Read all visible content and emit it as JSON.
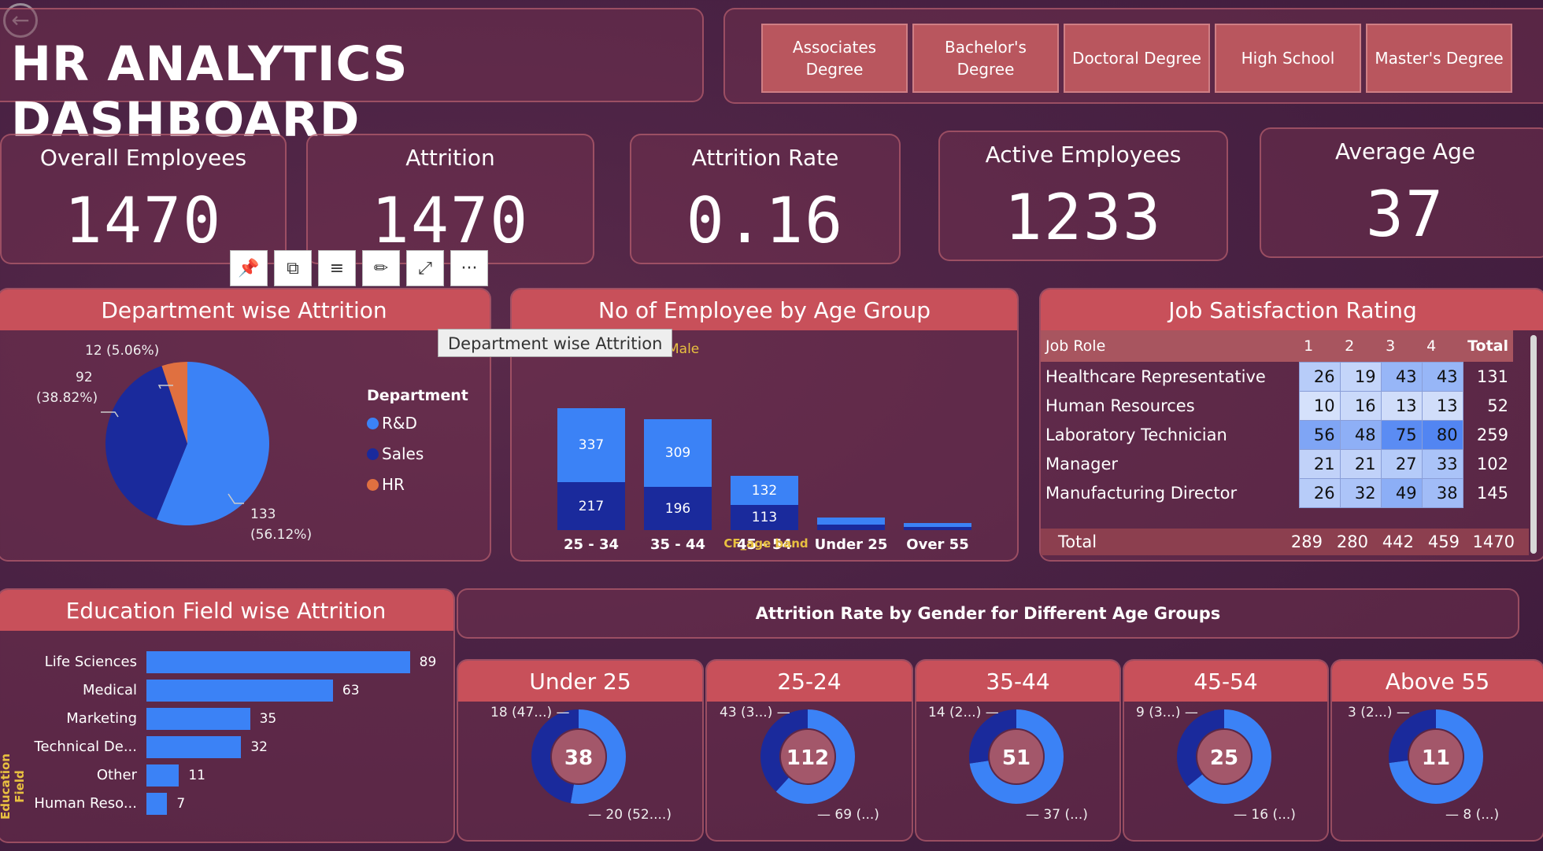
{
  "header": {
    "title": "HR ANALYTICS DASHBOARD",
    "back_icon": "arrow-left-icon"
  },
  "slicer": {
    "options": [
      "Associates Degree",
      "Bachelor's Degree",
      "Doctoral Degree",
      "High School",
      "Master's Degree"
    ]
  },
  "kpis": {
    "overall": {
      "label": "Overall Employees",
      "value": "1470"
    },
    "attrition": {
      "label": "Attrition",
      "value": "1470"
    },
    "rate": {
      "label": "Attrition Rate",
      "value": "0.16"
    },
    "active": {
      "label": "Active Employees",
      "value": "1233"
    },
    "avg_age": {
      "label": "Average Age",
      "value": "37"
    }
  },
  "toolbar": {
    "icons": [
      "pin-icon",
      "copy-icon",
      "filter-icon",
      "format-icon",
      "focus-mode-icon",
      "more-options-icon"
    ],
    "more_glyph": "···"
  },
  "tooltip": {
    "text": "Department wise Attrition"
  },
  "dept": {
    "title": "Department wise Attrition",
    "legend_title": "Department",
    "labels": {
      "hr": "12 (5.06%)",
      "sales_value": "92",
      "sales_pct": "(38.82%)",
      "rd_value": "133",
      "rd_pct": "(56.12%)"
    }
  },
  "age": {
    "title": "No of Employee by Age Group",
    "legend_partial": "Male",
    "xlabel": "CF_age band"
  },
  "job": {
    "title": "Job Satisfaction Rating",
    "headers": [
      "Job Role",
      "1",
      "2",
      "3",
      "4",
      "Total"
    ],
    "rows": [
      [
        "Healthcare Representative",
        "26",
        "19",
        "43",
        "43",
        "131"
      ],
      [
        "Human Resources",
        "10",
        "16",
        "13",
        "13",
        "52"
      ],
      [
        "Laboratory Technician",
        "56",
        "48",
        "75",
        "80",
        "259"
      ],
      [
        "Manager",
        "21",
        "21",
        "27",
        "33",
        "102"
      ],
      [
        "Manufacturing Director",
        "26",
        "32",
        "49",
        "38",
        "145"
      ]
    ],
    "total": [
      "Total",
      "289",
      "280",
      "442",
      "459",
      "1470"
    ]
  },
  "edu": {
    "title": "Education Field wise Attrition",
    "axis_label": "Education Field"
  },
  "gender": {
    "title": "Attrition Rate by Gender for Different Age Groups",
    "groups": [
      {
        "title": "Under 25",
        "center": "38",
        "top": "18 (47...)",
        "bottom": "20 (52....)"
      },
      {
        "title": "25-24",
        "center": "112",
        "top": "43 (3...)",
        "bottom": "69 (...)"
      },
      {
        "title": "35-44",
        "center": "51",
        "top": "14 (2...)",
        "bottom": "37 (...)"
      },
      {
        "title": "45-54",
        "center": "25",
        "top": "9 (3...)",
        "bottom": "16 (...)"
      },
      {
        "title": "Above 55",
        "center": "11",
        "top": "3 (2...)",
        "bottom": "8 (...)"
      }
    ]
  },
  "colors": {
    "accent": "#c8505a",
    "blue_light": "#3b82f6",
    "blue_dark": "#1a2a9c",
    "orange": "#e07040"
  },
  "chart_data": [
    {
      "type": "pie",
      "title": "Department wise Attrition",
      "categories": [
        "R&D",
        "Sales",
        "HR"
      ],
      "values": [
        133,
        92,
        12
      ],
      "colors": [
        "#3b82f6",
        "#1a2a9c",
        "#e07040"
      ],
      "legend": "right"
    },
    {
      "type": "bar",
      "stacked": true,
      "title": "No of Employee by Age Group",
      "xlabel": "CF_age band",
      "categories": [
        "25 - 34",
        "35 - 44",
        "45 - 54",
        "Under 25",
        "Over 55"
      ],
      "series": [
        {
          "name": "Male",
          "values": [
            217,
            196,
            113,
            25,
            16
          ]
        },
        {
          "name": "",
          "values": [
            337,
            309,
            132,
            31,
            17
          ]
        }
      ],
      "ylim": [
        0,
        600
      ]
    },
    {
      "type": "bar",
      "orientation": "horizontal",
      "title": "Education Field wise Attrition",
      "ylabel": "Education Field",
      "categories": [
        "Life Sciences",
        "Medical",
        "Marketing",
        "Technical De...",
        "Other",
        "Human Reso..."
      ],
      "values": [
        89,
        63,
        35,
        32,
        11,
        7
      ],
      "xlim": [
        0,
        100
      ]
    },
    {
      "type": "pie",
      "donut": true,
      "title": "Attrition Rate by Gender for Different Age Groups",
      "groups": [
        "Under 25",
        "25-24",
        "35-44",
        "45-54",
        "Above 55"
      ],
      "series": [
        {
          "values": [
            18,
            43,
            14,
            9,
            3
          ]
        },
        {
          "values": [
            20,
            69,
            37,
            16,
            8
          ]
        }
      ]
    }
  ]
}
